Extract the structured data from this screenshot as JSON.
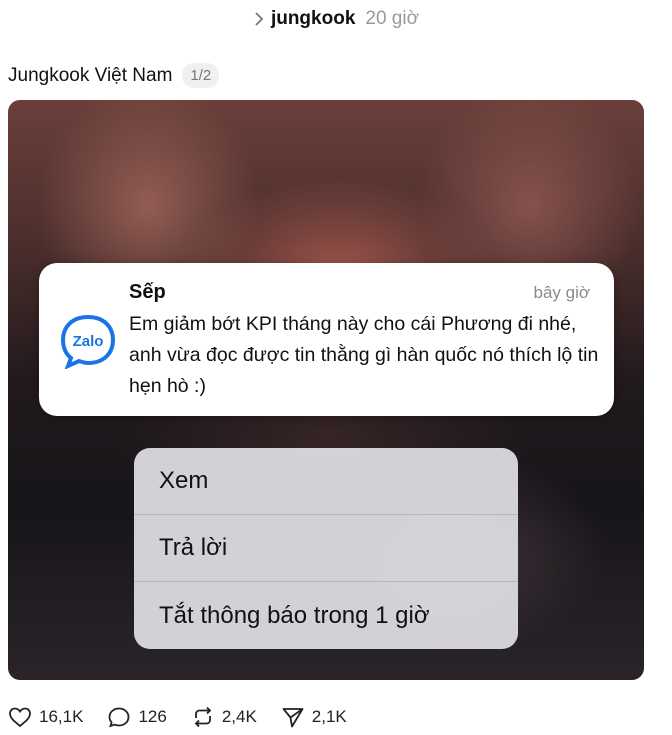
{
  "header": {
    "chevron_icon": "chevron-right-icon",
    "author": "jungkook",
    "time": "20 giờ"
  },
  "post": {
    "caption": "Jungkook Việt Nam",
    "page_indicator": "1/2"
  },
  "notification": {
    "app_icon": "zalo-logo",
    "app_icon_text": "Zalo",
    "app_color": "#1a74e8",
    "sender": "Sếp",
    "time": "bây giờ",
    "message": "Em giảm bớt KPI tháng này cho cái Phương đi nhé, anh vừa đọc được tin thằng gì hàn quốc nó thích lộ tin hẹn hò :)"
  },
  "context_menu": {
    "items": [
      {
        "label": "Xem"
      },
      {
        "label": "Trả lời"
      },
      {
        "label": "Tắt thông báo trong 1 giờ"
      }
    ]
  },
  "actions": {
    "like": {
      "icon": "heart-icon",
      "count": "16,1K"
    },
    "comment": {
      "icon": "comment-icon",
      "count": "126"
    },
    "repost": {
      "icon": "repost-icon",
      "count": "2,4K"
    },
    "share": {
      "icon": "send-icon",
      "count": "2,1K"
    }
  }
}
